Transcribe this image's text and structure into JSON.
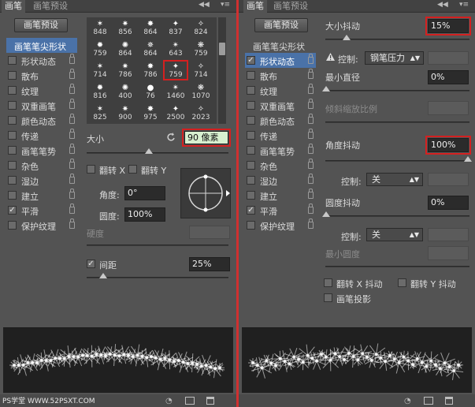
{
  "left": {
    "tabs": [
      "画笔",
      "画笔预设"
    ],
    "preset_button": "画笔预设",
    "sidebar": [
      {
        "label": "画笔笔尖形状",
        "checkbox": false,
        "selected": true,
        "lock": false
      },
      {
        "label": "形状动态",
        "checkbox": true,
        "checked": false,
        "lock": true
      },
      {
        "label": "散布",
        "checkbox": true,
        "checked": false,
        "lock": true
      },
      {
        "label": "纹理",
        "checkbox": true,
        "checked": false,
        "lock": true
      },
      {
        "label": "双重画笔",
        "checkbox": true,
        "checked": false,
        "lock": true
      },
      {
        "label": "颜色动态",
        "checkbox": true,
        "checked": false,
        "lock": true
      },
      {
        "label": "传递",
        "checkbox": true,
        "checked": false,
        "lock": true
      },
      {
        "label": "画笔笔势",
        "checkbox": true,
        "checked": false,
        "lock": true
      },
      {
        "label": "杂色",
        "checkbox": true,
        "checked": false,
        "lock": true
      },
      {
        "label": "湿边",
        "checkbox": true,
        "checked": false,
        "lock": true
      },
      {
        "label": "建立",
        "checkbox": true,
        "checked": false,
        "lock": true
      },
      {
        "label": "平滑",
        "checkbox": true,
        "checked": true,
        "lock": true
      },
      {
        "label": "保护纹理",
        "checkbox": true,
        "checked": false,
        "lock": true
      }
    ],
    "brush_sizes": [
      [
        "848",
        "856",
        "864",
        "837",
        "824"
      ],
      [
        "759",
        "864",
        "864",
        "643",
        "759"
      ],
      [
        "714",
        "786",
        "786",
        "759",
        "714"
      ],
      [
        "816",
        "400",
        "76",
        "1460",
        "1070"
      ],
      [
        "825",
        "900",
        "975",
        "2500",
        "2023"
      ]
    ],
    "selected_brush": "759",
    "size_label": "大小",
    "size_value": "90 像素",
    "flip_x": "翻转 X",
    "flip_y": "翻转 Y",
    "angle_label": "角度:",
    "angle_value": "0°",
    "roundness_label": "圆度:",
    "roundness_value": "100%",
    "hardness_label": "硬度",
    "spacing_label": "间距",
    "spacing_value": "25%",
    "watermark": "PS学堂 WWW.52PSXT.COM"
  },
  "right": {
    "tabs": [
      "画笔",
      "画笔预设"
    ],
    "preset_button": "画笔预设",
    "sidebar": [
      {
        "label": "画笔笔尖形状",
        "checkbox": false,
        "selected": false,
        "lock": false
      },
      {
        "label": "形状动态",
        "checkbox": true,
        "checked": true,
        "selected": true,
        "lock": true
      },
      {
        "label": "散布",
        "checkbox": true,
        "checked": false,
        "lock": true
      },
      {
        "label": "纹理",
        "checkbox": true,
        "checked": false,
        "lock": true
      },
      {
        "label": "双重画笔",
        "checkbox": true,
        "checked": false,
        "lock": true
      },
      {
        "label": "颜色动态",
        "checkbox": true,
        "checked": false,
        "lock": true
      },
      {
        "label": "传递",
        "checkbox": true,
        "checked": false,
        "lock": true
      },
      {
        "label": "画笔笔势",
        "checkbox": true,
        "checked": false,
        "lock": true
      },
      {
        "label": "杂色",
        "checkbox": true,
        "checked": false,
        "lock": true
      },
      {
        "label": "湿边",
        "checkbox": true,
        "checked": false,
        "lock": true
      },
      {
        "label": "建立",
        "checkbox": true,
        "checked": false,
        "lock": true
      },
      {
        "label": "平滑",
        "checkbox": true,
        "checked": true,
        "lock": true
      },
      {
        "label": "保护纹理",
        "checkbox": true,
        "checked": false,
        "lock": true
      }
    ],
    "size_jitter_label": "大小抖动",
    "size_jitter_value": "15%",
    "control_label": "控制:",
    "control_value_pen": "钢笔压力",
    "min_diameter_label": "最小直径",
    "min_diameter_value": "0%",
    "tilt_scale_label": "倾斜缩放比例",
    "angle_jitter_label": "角度抖动",
    "angle_jitter_value": "100%",
    "control_value_off": "关",
    "roundness_jitter_label": "圆度抖动",
    "roundness_jitter_value": "0%",
    "min_roundness_label": "最小圆度",
    "flip_x_jitter": "翻转 X 抖动",
    "flip_y_jitter": "翻转 Y 抖动",
    "brush_projection": "画笔投影"
  },
  "colors": {
    "panel": "#535353",
    "highlight": "#d42020",
    "selected": "#4a72a8"
  }
}
